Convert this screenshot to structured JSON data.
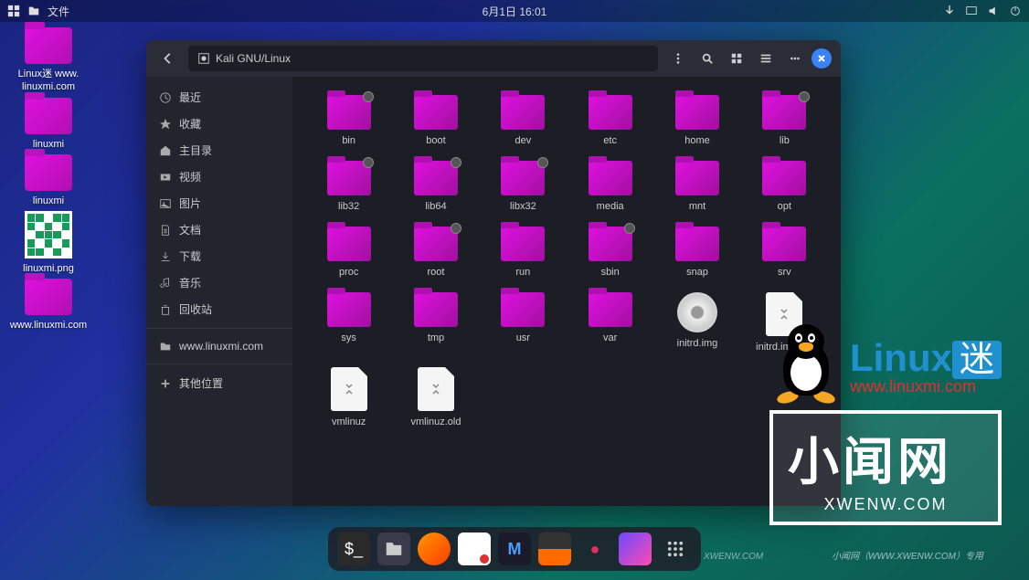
{
  "topbar": {
    "app": "文件",
    "datetime": "6月1日 16:01"
  },
  "desktop": {
    "items": [
      {
        "label": "Linux迷 www.\nlinuxmi.com",
        "type": "folder"
      },
      {
        "label": "linuxmi",
        "type": "folder"
      },
      {
        "label": "linuxmi",
        "type": "folder"
      },
      {
        "label": "linuxmi.png",
        "type": "qr"
      },
      {
        "label": "www.linuxmi.com",
        "type": "folder"
      }
    ]
  },
  "fm": {
    "path": "Kali GNU/Linux",
    "sidebar": [
      {
        "icon": "clock",
        "label": "最近"
      },
      {
        "icon": "star",
        "label": "收藏"
      },
      {
        "icon": "home",
        "label": "主目录"
      },
      {
        "icon": "video",
        "label": "视频"
      },
      {
        "icon": "image",
        "label": "图片"
      },
      {
        "icon": "doc",
        "label": "文档"
      },
      {
        "icon": "download",
        "label": "下载"
      },
      {
        "icon": "music",
        "label": "音乐"
      },
      {
        "icon": "trash",
        "label": "回收站"
      }
    ],
    "sidebar2": [
      {
        "icon": "folder",
        "label": "www.linuxmi.com"
      }
    ],
    "sidebar3": [
      {
        "icon": "plus",
        "label": "其他位置"
      }
    ],
    "files": [
      {
        "name": "bin",
        "type": "folder",
        "badge": true
      },
      {
        "name": "boot",
        "type": "folder"
      },
      {
        "name": "dev",
        "type": "folder"
      },
      {
        "name": "etc",
        "type": "folder"
      },
      {
        "name": "home",
        "type": "folder"
      },
      {
        "name": "lib",
        "type": "folder",
        "badge": true
      },
      {
        "name": "lib32",
        "type": "folder",
        "badge": true
      },
      {
        "name": "lib64",
        "type": "folder",
        "badge": true
      },
      {
        "name": "libx32",
        "type": "folder",
        "badge": true
      },
      {
        "name": "media",
        "type": "folder"
      },
      {
        "name": "mnt",
        "type": "folder"
      },
      {
        "name": "opt",
        "type": "folder"
      },
      {
        "name": "proc",
        "type": "folder"
      },
      {
        "name": "root",
        "type": "folder",
        "badge": true
      },
      {
        "name": "run",
        "type": "folder"
      },
      {
        "name": "sbin",
        "type": "folder",
        "badge": true
      },
      {
        "name": "snap",
        "type": "folder"
      },
      {
        "name": "srv",
        "type": "folder"
      },
      {
        "name": "sys",
        "type": "folder"
      },
      {
        "name": "tmp",
        "type": "folder"
      },
      {
        "name": "usr",
        "type": "folder"
      },
      {
        "name": "var",
        "type": "folder"
      },
      {
        "name": "initrd.img",
        "type": "disc"
      },
      {
        "name": "initrd.img.old",
        "type": "file"
      },
      {
        "name": "vmlinuz",
        "type": "file"
      },
      {
        "name": "vmlinuz.old",
        "type": "file"
      }
    ]
  },
  "watermark": {
    "linux": "Linux",
    "mi": "迷",
    "url": "www.linuxmi.com",
    "cn": "小闻网",
    "en": "XWENW.COM",
    "side": "XWENW.COM",
    "footer": "小闻网（WWW.XWENW.COM）专用"
  }
}
